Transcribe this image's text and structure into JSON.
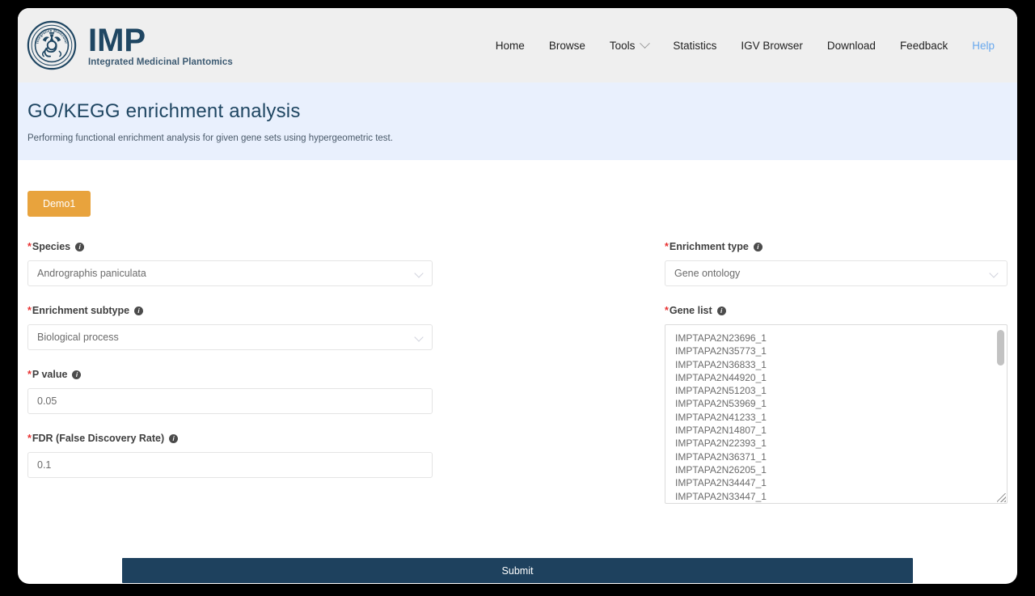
{
  "brand": {
    "title": "IMP",
    "subtitle": "Integrated Medicinal Plantomics",
    "emblem_icon": "circular-seal-icon",
    "emblem_ring_text": "Integrative Molecular Pharmacology"
  },
  "nav": {
    "items": [
      {
        "label": "Home",
        "icon": null,
        "accent": false
      },
      {
        "label": "Browse",
        "icon": null,
        "accent": false
      },
      {
        "label": "Tools",
        "icon": "chevron-down-icon",
        "accent": false
      },
      {
        "label": "Statistics",
        "icon": null,
        "accent": false
      },
      {
        "label": "IGV Browser",
        "icon": null,
        "accent": false
      },
      {
        "label": "Download",
        "icon": null,
        "accent": false
      },
      {
        "label": "Feedback",
        "icon": null,
        "accent": false
      },
      {
        "label": "Help",
        "icon": null,
        "accent": true
      }
    ]
  },
  "title_band": {
    "title": "GO/KEGG enrichment analysis",
    "description": "Performing functional enrichment analysis for given gene sets using hypergeometric test."
  },
  "demo": {
    "label": "Demo1"
  },
  "form": {
    "species": {
      "label": "Species",
      "required_mark": "*",
      "info_icon": "info-icon",
      "value": "Andrographis paniculata",
      "chevron_icon": "chevron-down-icon"
    },
    "enrichment_subtype": {
      "label": "Enrichment subtype",
      "required_mark": "*",
      "info_icon": "info-icon",
      "value": "Biological process",
      "chevron_icon": "chevron-down-icon"
    },
    "p_value": {
      "label": "P value",
      "required_mark": "*",
      "info_icon": "info-icon",
      "value": "0.05"
    },
    "fdr": {
      "label": "FDR (False Discovery Rate)",
      "required_mark": "*",
      "info_icon": "info-icon",
      "value": "0.1"
    },
    "enrichment_type": {
      "label": "Enrichment type",
      "required_mark": "*",
      "info_icon": "info-icon",
      "value": "Gene ontology",
      "chevron_icon": "chevron-down-icon"
    },
    "gene_list": {
      "label": "Gene list",
      "required_mark": "*",
      "info_icon": "info-icon",
      "scrollbar_icon": "vertical-scrollbar",
      "resize_icon": "resize-handle-icon",
      "values": [
        "IMPTAPA2N23696_1",
        "IMPTAPA2N35773_1",
        "IMPTAPA2N36833_1",
        "IMPTAPA2N44920_1",
        "IMPTAPA2N51203_1",
        "IMPTAPA2N53969_1",
        "IMPTAPA2N41233_1",
        "IMPTAPA2N14807_1",
        "IMPTAPA2N22393_1",
        "IMPTAPA2N36371_1",
        "IMPTAPA2N26205_1",
        "IMPTAPA2N34447_1",
        "IMPTAPA2N33447_1"
      ]
    }
  },
  "submit": {
    "label": "Submit"
  },
  "colors": {
    "brand_dark": "#1f4662",
    "accent_orange": "#e8a33d",
    "submit_blue": "#1e415e",
    "help_blue": "#6aa9ee",
    "title_band_bg": "#e9f0fd",
    "header_bg": "#efefef",
    "required_red": "#e83030"
  }
}
